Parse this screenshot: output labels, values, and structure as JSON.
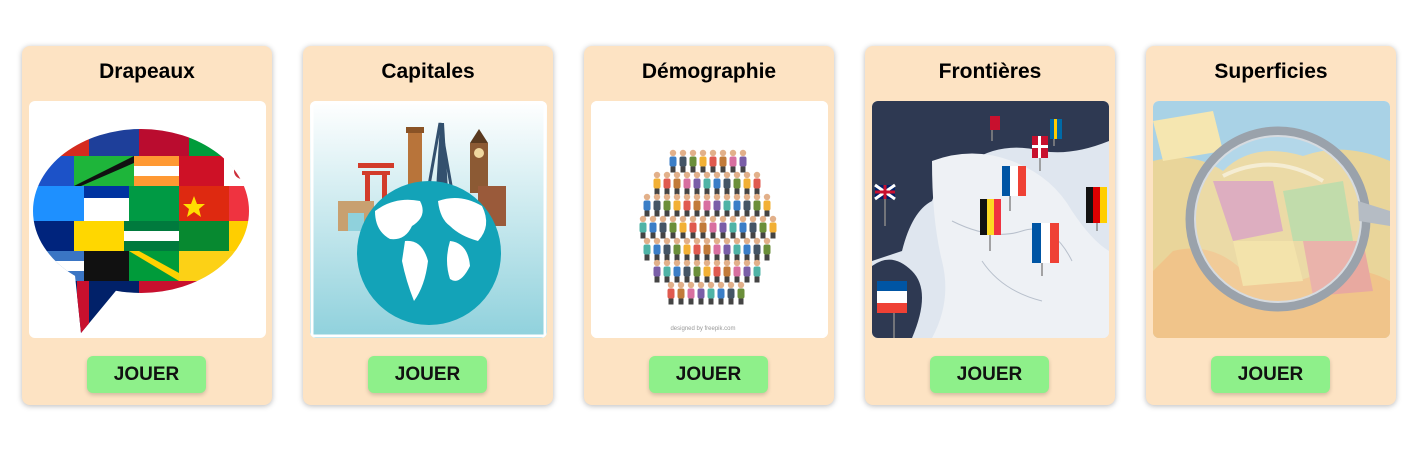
{
  "cards": [
    {
      "title": "Drapeaux",
      "button": "JOUER",
      "image": "flags-speech-bubble"
    },
    {
      "title": "Capitales",
      "button": "JOUER",
      "image": "globe-landmarks"
    },
    {
      "title": "Démographie",
      "button": "JOUER",
      "image": "crowd-of-people"
    },
    {
      "title": "Frontières",
      "button": "JOUER",
      "image": "europe-map-flag-pins"
    },
    {
      "title": "Superficies",
      "button": "JOUER",
      "image": "map-magnifying-glass"
    }
  ],
  "watermark": "designed by freepik.com",
  "colors": {
    "card_bg": "#fde3c3",
    "button_bg": "#8ef08a"
  }
}
